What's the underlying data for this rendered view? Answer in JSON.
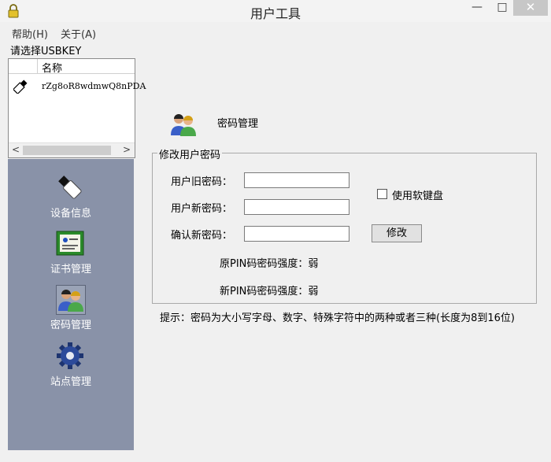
{
  "window": {
    "title": "用户工具",
    "controls": {
      "minimize": "—",
      "maximize": "□",
      "close": "✕"
    }
  },
  "menu": {
    "help": "帮助(H)",
    "about": "关于(A)"
  },
  "usbkey": {
    "prompt": "请选择USBKEY",
    "column_header": "名称",
    "items": [
      {
        "label": "rZg8oR8wdmwQ8nPDA"
      }
    ],
    "scroll_left": "<",
    "scroll_right": ">"
  },
  "nav": {
    "items": [
      {
        "label": "设备信息",
        "icon": "usb-key-icon"
      },
      {
        "label": "证书管理",
        "icon": "certificate-icon"
      },
      {
        "label": "密码管理",
        "icon": "users-icon"
      },
      {
        "label": "站点管理",
        "icon": "gear-icon"
      }
    ],
    "selected": "密码管理"
  },
  "main": {
    "header_title": "密码管理",
    "group_title": "修改用户密码",
    "old_password_label": "用户旧密码：",
    "new_password_label": "用户新密码：",
    "confirm_password_label": "确认新密码：",
    "old_password_value": "",
    "new_password_value": "",
    "confirm_password_value": "",
    "soft_keyboard_label": "使用软键盘",
    "soft_keyboard_checked": false,
    "modify_button": "修改",
    "old_pin_strength": "原PIN码密码强度：弱",
    "new_pin_strength": "新PIN码密码强度：弱",
    "hint": "提示：密码为大小写字母、数字、特殊字符中的两种或者三种(长度为8到16位)"
  }
}
